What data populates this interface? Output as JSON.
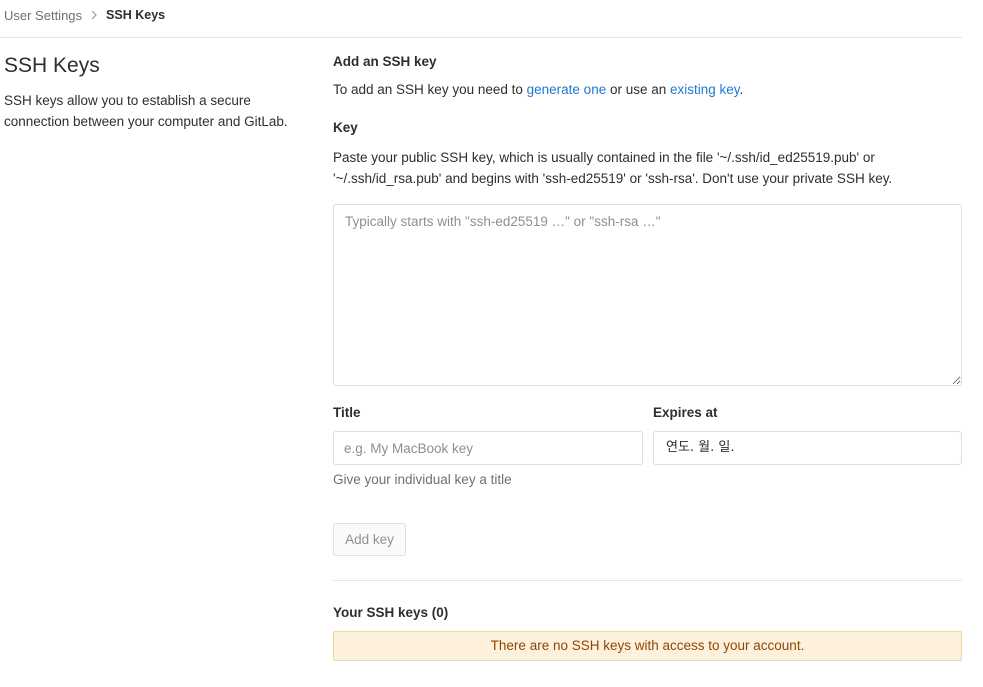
{
  "breadcrumb": {
    "parent": "User Settings",
    "current": "SSH Keys"
  },
  "intro": {
    "title": "SSH Keys",
    "description": "SSH keys allow you to establish a secure connection between your computer and GitLab."
  },
  "add_key": {
    "heading": "Add an SSH key",
    "instructions_prefix": "To add an SSH key you need to ",
    "generate_link": "generate one",
    "instructions_middle": " or use an ",
    "existing_link": "existing key",
    "instructions_suffix": "."
  },
  "key_field": {
    "label": "Key",
    "help": "Paste your public SSH key, which is usually contained in the file '~/.ssh/id_ed25519.pub' or '~/.ssh/id_rsa.pub' and begins with 'ssh-ed25519' or 'ssh-rsa'. Don't use your private SSH key.",
    "placeholder": "Typically starts with \"ssh-ed25519 …\" or \"ssh-rsa …\"",
    "value": ""
  },
  "title_field": {
    "label": "Title",
    "placeholder": "e.g. My MacBook key",
    "help": "Give your individual key a title"
  },
  "expires_field": {
    "label": "Expires at",
    "value": "연도. 월. 일."
  },
  "submit": {
    "label": "Add key",
    "disabled": true
  },
  "keys_list": {
    "heading": "Your SSH keys (0)",
    "empty_message": "There are no SSH keys with access to your account."
  },
  "colors": {
    "link": "#1f78d1",
    "alert_bg": "#fdf1dd",
    "alert_text": "#8f4700"
  }
}
